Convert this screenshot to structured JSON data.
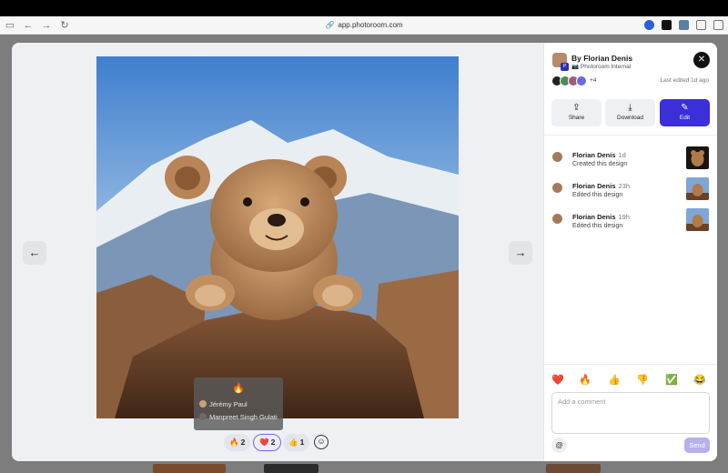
{
  "browser": {
    "url": "app.photoroom.com"
  },
  "sidebar": {
    "author": "By Florian Denis",
    "org": "📷 Photoroom Internal",
    "viewers_more": "+4",
    "last_edited": "Last edited 1d ago",
    "actions": [
      {
        "label": "Share",
        "icon": "share-icon"
      },
      {
        "label": "Download",
        "icon": "download-icon"
      },
      {
        "label": "Edit",
        "icon": "pencil-icon"
      }
    ],
    "activity": [
      {
        "name": "Florian Denis",
        "time": "1d",
        "text": "Created this design"
      },
      {
        "name": "Florian Denis",
        "time": "23h",
        "text": "Edited this design"
      },
      {
        "name": "Florian Denis",
        "time": "19h",
        "text": "Edited this design"
      }
    ],
    "quick_emojis": [
      "❤️",
      "🔥",
      "👍",
      "👎",
      "✅",
      "😂"
    ],
    "comment_placeholder": "Add a comment",
    "mention_label": "@",
    "send_label": "Send"
  },
  "viewer": {
    "tooltip": {
      "emoji": "🔥",
      "users": [
        "Jérémy Paul",
        "Manpreet Singh Gulati"
      ]
    },
    "reactions": [
      {
        "emoji": "🔥",
        "count": "2"
      },
      {
        "emoji": "❤️",
        "count": "2"
      },
      {
        "emoji": "👍",
        "count": "1"
      }
    ]
  },
  "colors": {
    "accent": "#3a2fd8",
    "send_disabled": "#b6b0ee"
  }
}
